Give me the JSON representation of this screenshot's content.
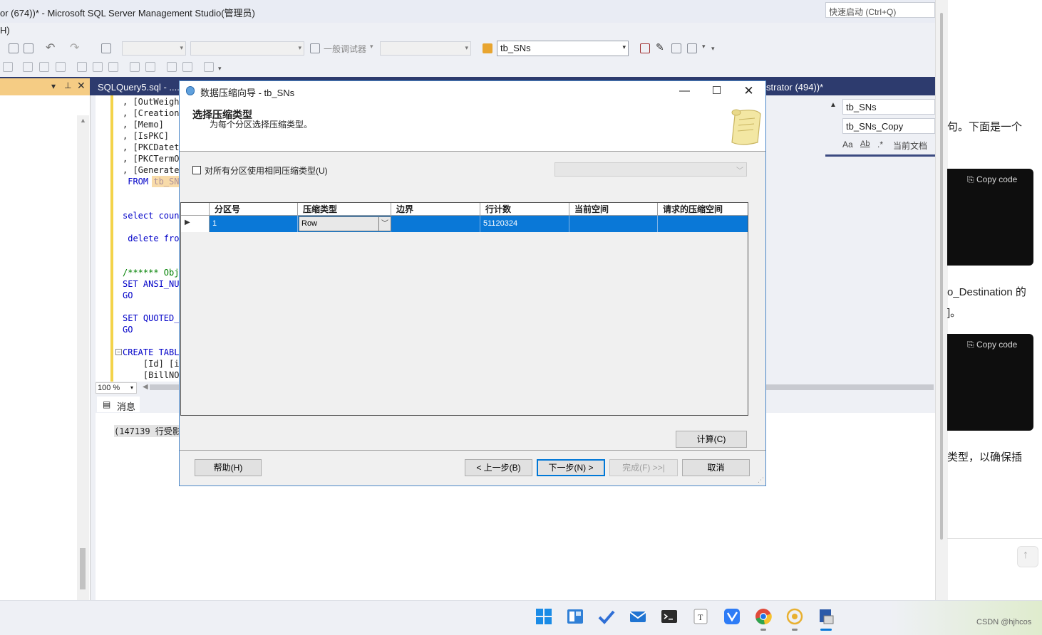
{
  "ssms": {
    "window_title": "or (674))* - Microsoft SQL Server Management Studio(管理员)",
    "menu_fragment": "H)",
    "quick_launch_placeholder": "快速启动 (Ctrl+Q)",
    "toolbar": {
      "debugger_label": "一般调试器",
      "database_combo": "tb_SNs"
    },
    "tabs": {
      "query_tab": "SQLQuery5.sql - ....",
      "right_tab": "strator (494))*"
    },
    "editor_lines": [
      ", [OutWeight]",
      ", [CreationD",
      ", [Memo]",
      ", [IsPKC]",
      ", [PKCDateti",
      ", [PKCTermOf",
      ", [GenerateT",
      " FROM tb_SN",
      "",
      "",
      "select coun",
      "",
      " delete fro",
      "",
      "",
      "/****** Obj",
      "SET ANSI_NU",
      "GO",
      "",
      "SET QUOTED_",
      "GO",
      "",
      "CREATE TABL",
      "    [Id] [i",
      "    [BillNO]"
    ],
    "zoom": "100 %",
    "messages_tab": "消息",
    "messages_text": "(147139 行受影",
    "find": {
      "search_value": "tb_SNs",
      "replace_value": "tb_SNs_Copy",
      "scope_label": "当前文档",
      "match_case": "Aa",
      "whole_word": "Ab"
    }
  },
  "dialog": {
    "title": "数据压缩向导 - tb_SNs",
    "header_title": "选择压缩类型",
    "header_subtitle": "为每个分区选择压缩类型。",
    "checkbox_label": "对所有分区使用相同压缩类型(U)",
    "checkbox_checked": false,
    "grid": {
      "columns": [
        "分区号",
        "压缩类型",
        "边界",
        "行计数",
        "当前空间",
        "请求的压缩空间"
      ],
      "rows": [
        {
          "partition": "1",
          "compression": "Row",
          "boundary": "",
          "row_count": "51120324",
          "current_space": "",
          "requested_space": ""
        }
      ]
    },
    "buttons": {
      "calculate": "计算(C)",
      "help": "帮助(H)",
      "back": "< 上一步(B)",
      "next": "下一步(N) >",
      "finish": "完成(F) >>|",
      "cancel": "取消"
    }
  },
  "browser": {
    "text_1": "句。下面是一个",
    "text_2": "o_Destination 的",
    "text_3": "]。",
    "text_4": "类型，以确保插",
    "copy_label": "Copy code",
    "watermark": "CSDN @hjhcos"
  },
  "colors": {
    "accent": "#0a78d7",
    "tab_bar": "#2d3b6e",
    "code_bg": "#0e0e0e"
  }
}
